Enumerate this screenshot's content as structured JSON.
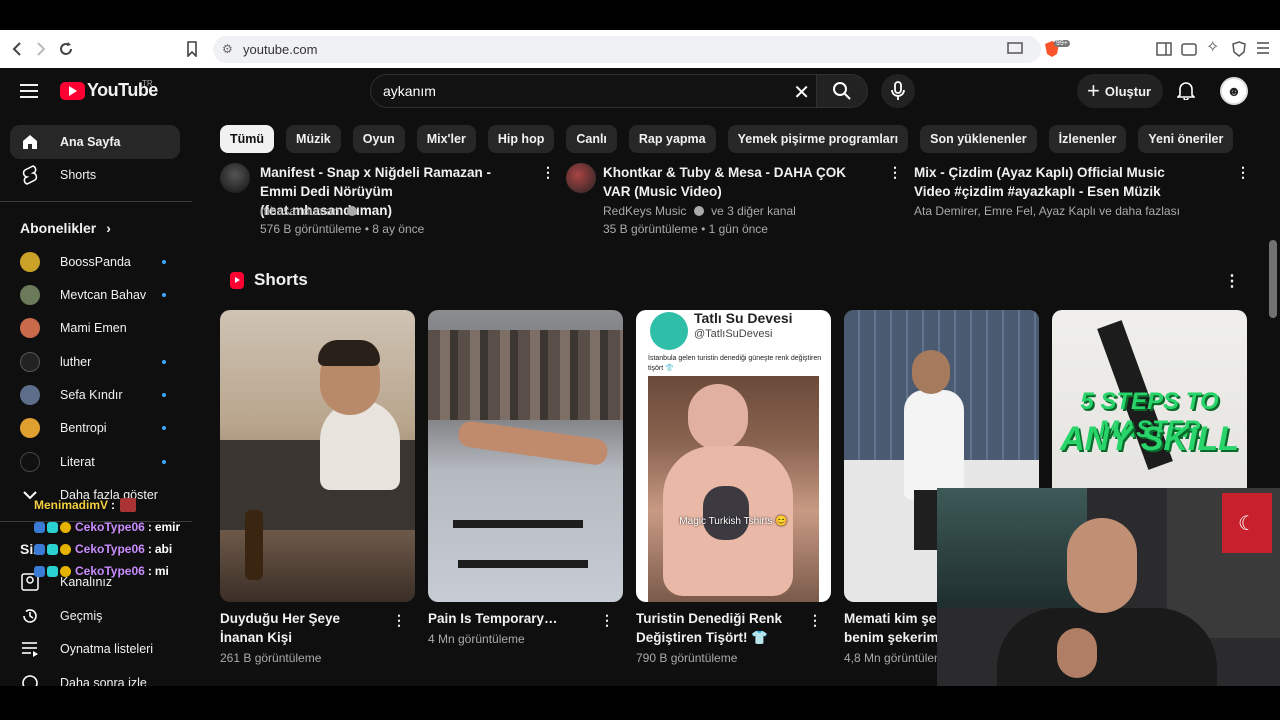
{
  "browser": {
    "url": "youtube.com",
    "brave_badge": "99+"
  },
  "header": {
    "logo_text": "YouTube",
    "country_code": "TR",
    "search_value": "aykanım",
    "create_label": "Oluştur"
  },
  "sidebar": {
    "home": "Ana Sayfa",
    "shorts": "Shorts",
    "subscriptions_heading": "Abonelikler",
    "subscriptions": [
      {
        "name": "BoossPanda",
        "color": "#c9a227"
      },
      {
        "name": "Mevtcan Bahav",
        "color": "#6b7b5a"
      },
      {
        "name": "Mami Emen",
        "color": "#c96a4a"
      },
      {
        "name": "luther",
        "color": "#222222"
      },
      {
        "name": "Sefa Kındır",
        "color": "#5d6e8a"
      },
      {
        "name": "Bentropi",
        "color": "#e0a030"
      },
      {
        "name": "Literat",
        "color": "#111111"
      }
    ],
    "show_more": "Daha fazla göster",
    "you_heading": "Siz",
    "your_channel": "Kanalınız",
    "history": "Geçmiş",
    "playlists": "Oynatma listeleri",
    "partial_item": "Daha sonra izle"
  },
  "chips": [
    "Tümü",
    "Müzik",
    "Oyun",
    "Mix'ler",
    "Hip hop",
    "Canlı",
    "Rap yapma",
    "Yemek pişirme programları",
    "Son yüklenenler",
    "İzlenenler",
    "Yeni öneriler"
  ],
  "videos": [
    {
      "title": "Manifest - Snap x Niğdeli Ramazan - Emmi Dedi Nörüyüm (feat.mhasanduman)",
      "channel": "mhasanduman",
      "meta": "576 B görüntüleme • 8 ay önce"
    },
    {
      "title": "Khontkar & Tuby & Mesa - DAHA ÇOK VAR (Music Video)",
      "channel": "RedKeys Music",
      "channel_extra": "ve 3 diğer kanal",
      "meta": "35 B görüntüleme • 1 gün önce"
    },
    {
      "title": "Mix - Çizdim (Ayaz Kaplı) Official Music Video #çizdim #ayazkaplı - Esen Müzik",
      "channel": "Ata Demirer, Emre Fel, Ayaz Kaplı ve daha fazlası"
    }
  ],
  "shorts_section": {
    "heading": "Shorts",
    "items": [
      {
        "title": "Duyduğu Her Şeye İnanan Kişi",
        "views": "261 B görüntüleme"
      },
      {
        "title": "Pain Is Temporary…",
        "views": "4 Mn görüntüleme"
      },
      {
        "title": "Turistin Denediği Renk Değiştiren Tişört! 👕",
        "views": "790 B görüntüleme",
        "overlay_brand": "Tatlı Su Devesi",
        "overlay_handle": "@TatlıSuDevesi",
        "overlay_caption": "İstanbula gelen turistin denediği güneşte renk değiştiren tişört 👕",
        "overlay_bottom": "Magic Turkish Tshirts 😊"
      },
      {
        "title": "Memati kim şekerim benim şekerim",
        "views": "4,8 Mn görüntüleme"
      },
      {
        "title": "5 STEPS TO MASTER ANY SKILL",
        "views": "",
        "overlay_text_1": "5 STEPS TO MASTER",
        "overlay_text_2": "ANY SKILL"
      }
    ]
  },
  "chat": [
    {
      "user": "MenimadimV",
      "message": "",
      "color": "#f5d142"
    },
    {
      "user": "CekoType06",
      "message": "emir",
      "color": "#c98cff"
    },
    {
      "user": "CekoType06",
      "message": "abi",
      "color": "#c98cff"
    },
    {
      "user": "CekoType06",
      "message": "mi",
      "color": "#c98cff"
    }
  ]
}
